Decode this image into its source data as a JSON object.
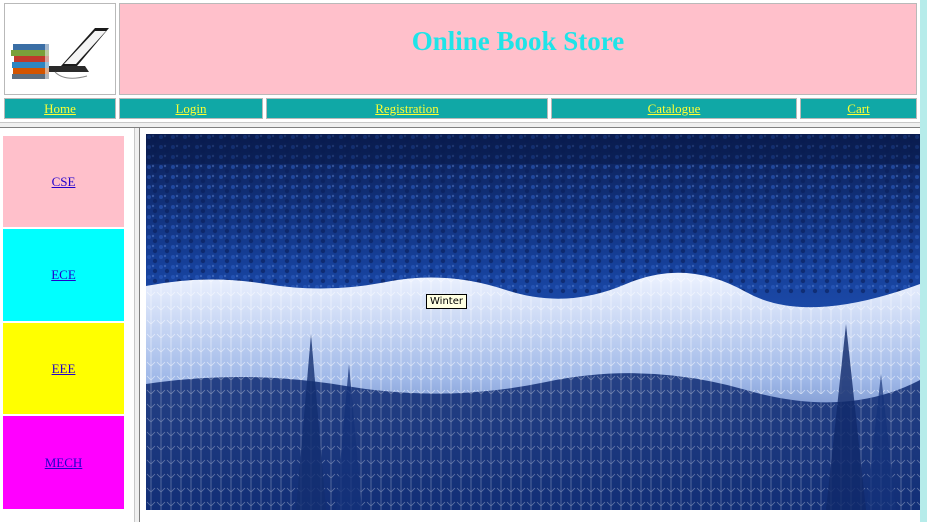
{
  "header": {
    "title": "Online Book Store",
    "logo_icon": "books-and-laptop-icon"
  },
  "nav": {
    "home": "Home",
    "login": "Login",
    "registration": "Registration",
    "catalogue": "Catalogue",
    "cart": "Cart"
  },
  "categories": {
    "cse": "CSE",
    "ece": "ECE",
    "eee": "EEE",
    "mech": "MECH"
  },
  "main": {
    "image_tooltip": "Winter"
  },
  "colors": {
    "title_bg": "#ffc0cb",
    "title_text": "#1fe4e8",
    "nav_bg": "#10a8a6",
    "nav_link": "#ffff33",
    "cse_bg": "#ffc0cb",
    "ece_bg": "#00ffff",
    "eee_bg": "#ffff00",
    "mech_bg": "#ff00ff"
  }
}
